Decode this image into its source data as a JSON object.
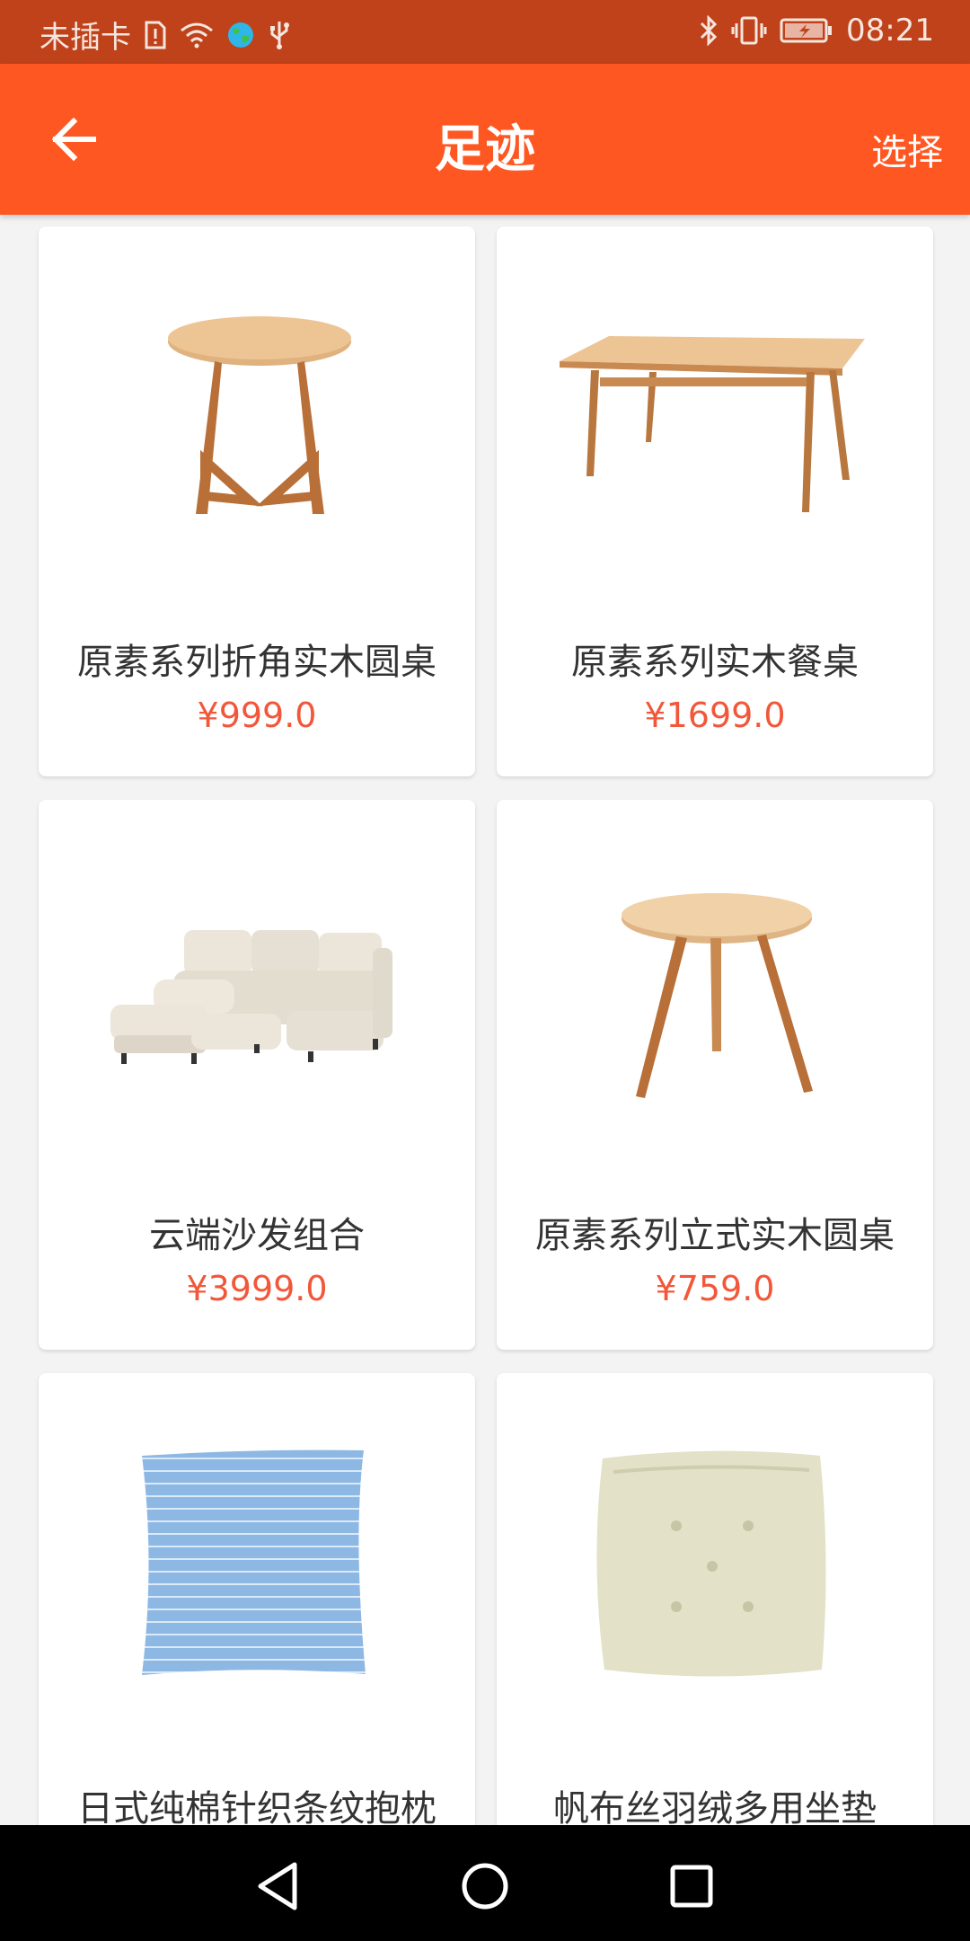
{
  "status_bar": {
    "carrier": "未插卡",
    "time": "08:21",
    "icons": [
      "sim-alert-icon",
      "wifi-icon",
      "globe-icon",
      "usb-icon",
      "bluetooth-icon",
      "vibrate-icon",
      "battery-charging-icon"
    ]
  },
  "app_bar": {
    "title": "足迹",
    "action": "选择"
  },
  "products": [
    {
      "name": "原素系列折角实木圆桌",
      "price": "¥999.0",
      "image": "round-table-image"
    },
    {
      "name": "原素系列实木餐桌",
      "price": "¥1699.0",
      "image": "dining-table-image"
    },
    {
      "name": "云端沙发组合",
      "price": "¥3999.0",
      "image": "sofa-image"
    },
    {
      "name": "原素系列立式实木圆桌",
      "price": "¥759.0",
      "image": "standing-round-table-image"
    },
    {
      "name": "日式纯棉针织条纹抱枕",
      "price": "",
      "image": "striped-pillow-image"
    },
    {
      "name": "帆布丝羽绒多用坐垫",
      "price": "",
      "image": "seat-cushion-image"
    }
  ],
  "colors": {
    "status_bar": "#c0421a",
    "app_bar": "#ff5722",
    "price": "#f2573a"
  },
  "nav_bar": [
    "back-triangle-icon",
    "home-circle-icon",
    "recents-square-icon"
  ]
}
